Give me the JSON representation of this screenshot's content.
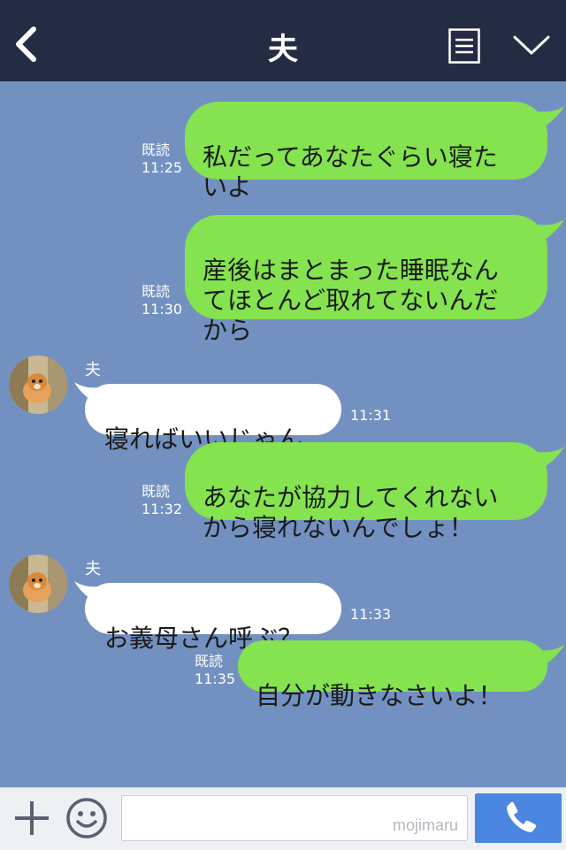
{
  "header": {
    "title": "夫",
    "back_icon": "chevron-left-icon",
    "menu_icon": "menu-list-icon",
    "collapse_icon": "chevron-down-icon",
    "background": "#232c43"
  },
  "chat": {
    "background": "#7391c0",
    "sent_bubble_color": "#84e34e",
    "received_bubble_color": "#ffffff",
    "messages": [
      {
        "side": "sent",
        "text": "私だってあなたぐらい寝た\nいよ",
        "read_label": "既読",
        "time": "11:25"
      },
      {
        "side": "sent",
        "text": "産後はまとまった睡眠なん\nてほとんど取れてないんだ\nから",
        "read_label": "既読",
        "time": "11:30"
      },
      {
        "side": "received",
        "sender": "夫",
        "text": "寝ればいいじゃん",
        "time": "11:31"
      },
      {
        "side": "sent",
        "text": "あなたが協力してくれない\nから寝れないんでしょ！",
        "read_label": "既読",
        "time": "11:32"
      },
      {
        "side": "received",
        "sender": "夫",
        "text": "お義母さん呼ぶ？",
        "time": "11:33"
      },
      {
        "side": "sent",
        "text": "自分が動きなさいよ！",
        "read_label": "既読",
        "time": "11:35"
      }
    ]
  },
  "input_bar": {
    "plus_icon": "plus-icon",
    "emoji_icon": "smiley-icon",
    "message_value": "",
    "watermark": "mojimaru",
    "call_icon": "phone-icon",
    "call_button_color": "#4b86e0"
  }
}
